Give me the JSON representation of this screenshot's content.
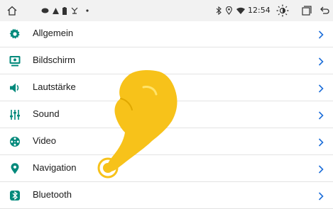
{
  "status_bar": {
    "time": "12:54",
    "icons": [
      "home-icon",
      "notification-icon",
      "warning-icon",
      "battery-icon",
      "signal-icon",
      "dot-icon",
      "bluetooth-icon",
      "location-icon",
      "wifi-icon",
      "brightness-icon",
      "recent-apps-icon",
      "back-icon"
    ]
  },
  "settings": {
    "items": [
      {
        "label": "Allgemein",
        "icon": "gear-icon"
      },
      {
        "label": "Bildschirm",
        "icon": "display-icon"
      },
      {
        "label": "Lautstärke",
        "icon": "speaker-icon"
      },
      {
        "label": "Sound",
        "icon": "equalizer-icon"
      },
      {
        "label": "Video",
        "icon": "film-reel-icon"
      },
      {
        "label": "Navigation",
        "icon": "map-pin-icon"
      },
      {
        "label": "Bluetooth",
        "icon": "bluetooth-icon"
      }
    ]
  },
  "colors": {
    "accent": "#00897b",
    "chevron": "#1e6fd9",
    "status_bar": "#f2f2f2",
    "divider": "#e3e3e3",
    "hand": "#f7c21a"
  }
}
